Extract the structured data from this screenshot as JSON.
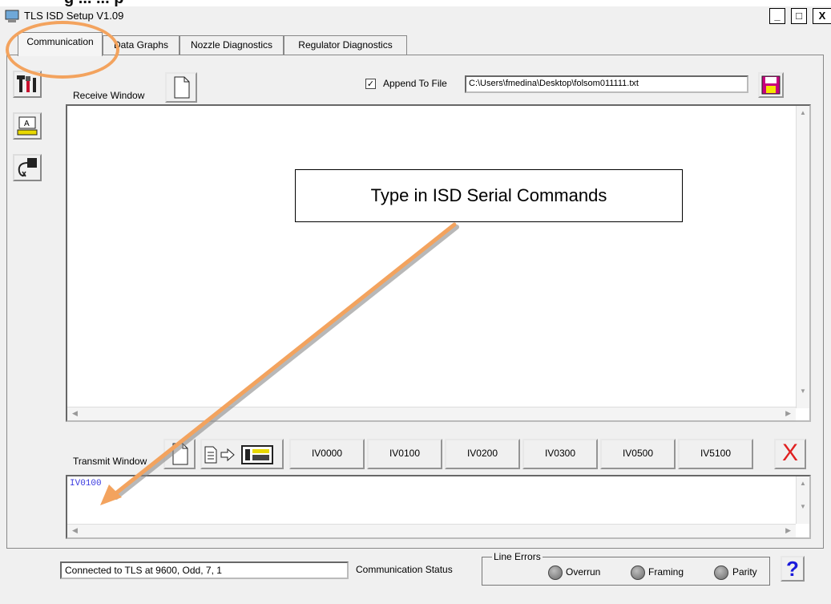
{
  "header_partial": "g ... ... p",
  "window": {
    "title": "TLS ISD Setup V1.09",
    "minimize": "_",
    "maximize": "□",
    "close": "X"
  },
  "tabs": [
    {
      "label": "Communication"
    },
    {
      "label": "Data Graphs"
    },
    {
      "label": "Nozzle Diagnostics"
    },
    {
      "label": "Regulator Diagnostics"
    }
  ],
  "receive": {
    "label": "Receive Window",
    "append_checked": true,
    "append_label": "Append To File",
    "file_path": "C:\\Users\\fmedina\\Desktop\\folsom011111.txt",
    "content": ""
  },
  "transmit": {
    "label": "Transmit Window",
    "commands": [
      "IV0000",
      "IV0100",
      "IV0200",
      "IV0300",
      "IV0500",
      "IV5100"
    ],
    "input_value": "IV0100",
    "clear_glyph": "X"
  },
  "status": {
    "connection": "Connected to TLS at 9600, Odd, 7, 1",
    "comm_label": "Communication Status",
    "line_errors_label": "Line Errors",
    "indicators": [
      "Overrun",
      "Framing",
      "Parity"
    ],
    "help_glyph": "?"
  },
  "callout": {
    "text": "Type in ISD Serial Commands"
  },
  "colors": {
    "annotation_orange": "#f3a35e",
    "save_magenta": "#c8007f",
    "clear_red": "#e02020",
    "help_blue": "#1a1adb",
    "command_text": "#3a3ae0"
  },
  "icons": [
    "app-icon",
    "tools-icon",
    "keyboard-icon",
    "cable-icon",
    "new-document-icon",
    "save-disk-icon",
    "text-file-icon",
    "arrow-right-icon",
    "calculator-icon",
    "clear-x-icon",
    "help-icon"
  ]
}
